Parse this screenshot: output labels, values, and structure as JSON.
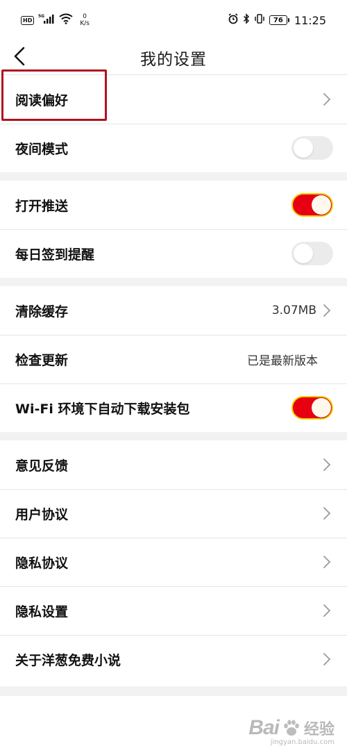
{
  "status_bar": {
    "hd": "HD",
    "signal_sup": "5G",
    "net_speed_value": "0",
    "net_speed_unit": "K/s",
    "battery": "76",
    "time": "11:25"
  },
  "nav": {
    "title": "我的设置"
  },
  "sections": {
    "s1": {
      "reading_pref": "阅读偏好",
      "night_mode": "夜间模式",
      "night_mode_on": false
    },
    "s2": {
      "push": "打开推送",
      "push_on": true,
      "checkin_reminder": "每日签到提醒",
      "checkin_on": false
    },
    "s3": {
      "clear_cache": "清除缓存",
      "cache_size": "3.07MB",
      "check_update": "检查更新",
      "update_status": "已是最新版本",
      "wifi_download": "Wi-Fi 环境下自动下载安装包",
      "wifi_download_on": true
    },
    "s4": {
      "feedback": "意见反馈",
      "user_agreement": "用户协议",
      "privacy_agreement": "隐私协议",
      "privacy_settings": "隐私设置",
      "about": "关于洋葱免费小说"
    }
  },
  "colors": {
    "toggle_on": "#e60012",
    "toggle_on_border": "#f2d000",
    "toggle_off": "#ebebeb",
    "highlight": "#b0121e"
  },
  "watermark": {
    "brand": "Bai",
    "brand_suffix": "经验",
    "url": "jingyan.baidu.com"
  }
}
